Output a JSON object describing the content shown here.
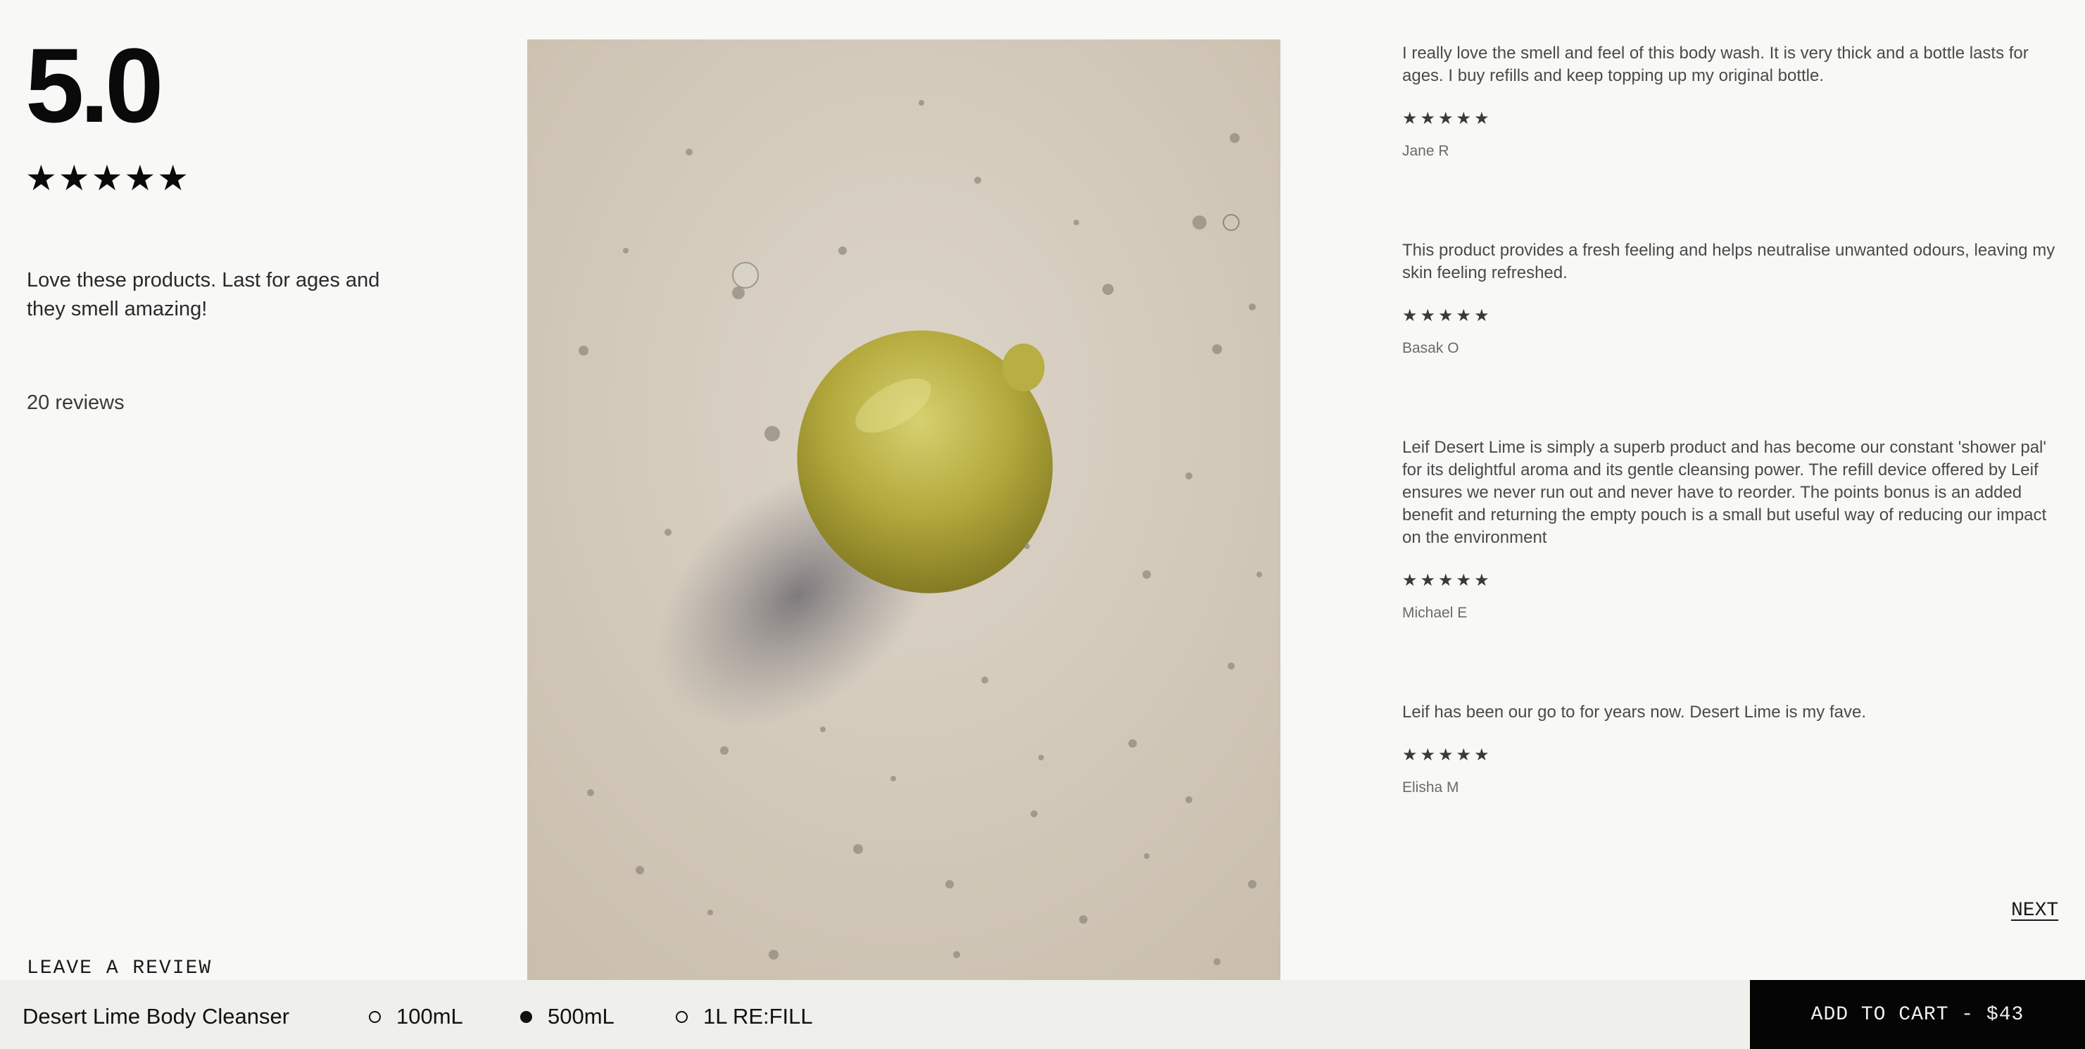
{
  "summary": {
    "score": "5.0",
    "stars": "★★★★★",
    "quote": "Love these products. Last for ages and they smell amazing!",
    "review_count": "20 reviews",
    "leave_review_label": "LEAVE A REVIEW"
  },
  "reviews": [
    {
      "text": "I really love the smell and feel of this body wash. It is very thick and a bottle lasts for ages. I buy refills and keep topping up my original bottle.",
      "stars": "★★★★★",
      "rating": 5,
      "author": "Jane R"
    },
    {
      "text": "This product provides a fresh feeling and helps neutralise unwanted odours, leaving my skin feeling refreshed.",
      "stars": "★★★★★",
      "rating": 5,
      "author": "Basak O"
    },
    {
      "text": "Leif Desert Lime is simply a superb product and has become our constant 'shower pal' for its delightful aroma and its gentle cleansing power. The refill device offered by Leif ensures we never run out and never have to reorder. The points bonus is an added benefit and returning the empty pouch is a small but useful way of reducing our impact on the environment",
      "stars": "★★★★★",
      "rating": 5,
      "author": "Michael E"
    },
    {
      "text": "Leif has been our go to for years now. Desert Lime is my fave.",
      "stars": "★★★★★",
      "rating": 5,
      "author": "Elisha M"
    }
  ],
  "pagination": {
    "next_label": "NEXT"
  },
  "product_bar": {
    "name": "Desert Lime Body Cleanser",
    "sizes": [
      {
        "label": "100mL",
        "selected": false
      },
      {
        "label": "500mL",
        "selected": true
      },
      {
        "label": "1L RE:FILL",
        "selected": false
      }
    ],
    "add_to_cart_label": "ADD TO CART - $43"
  },
  "image": {
    "subject": "lime-with-gel-droplets"
  },
  "colors": {
    "background": "#f8f8f6",
    "bar_background": "#efefeb",
    "cta_background": "#050505",
    "lime": "#b5ab3e"
  }
}
